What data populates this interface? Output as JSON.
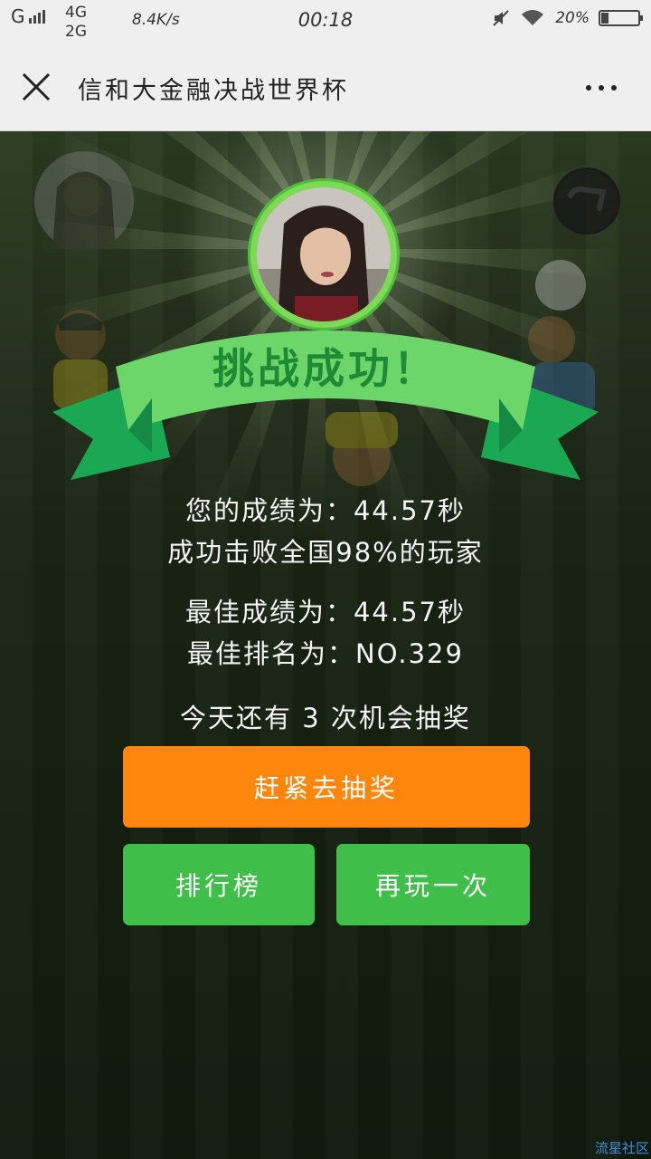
{
  "status_bar": {
    "carrier1": "G",
    "net_top": "4G",
    "net_bottom": "2G",
    "speed": "8.4K/s",
    "time": "00:18",
    "battery": "20%",
    "battery_level": 0.2
  },
  "title_bar": {
    "title": "信和大金融决战世界杯"
  },
  "result": {
    "heading": "挑战成功！",
    "score_line": "您的成绩为：44.57秒",
    "beat_line": "成功击败全国98%的玩家",
    "best_score_line": "最佳成绩为：44.57秒",
    "best_rank_line": "最佳排名为：NO.329",
    "chances_line": "今天还有 3 次机会抽奖"
  },
  "buttons": {
    "lottery": "赶紧去抽奖",
    "leaderboard": "排行榜",
    "play_again": "再玩一次"
  },
  "colors": {
    "accent_orange": "#ff860d",
    "accent_green": "#3fbf4a",
    "ribbon_green": "#6dd66b"
  },
  "watermark": "流星社区"
}
